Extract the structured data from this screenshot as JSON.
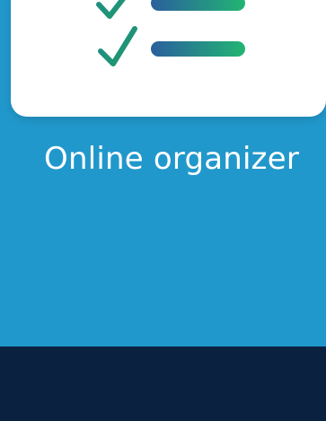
{
  "feature": {
    "title": "Online organizer",
    "icon": "checklist-icon"
  },
  "colors": {
    "background": "#2198cc",
    "card": "#ffffff",
    "footer": "#0a2240",
    "check": "#1f8a8a",
    "bar_gradient_start": "#2a5f9e",
    "bar_gradient_end": "#22b573"
  }
}
